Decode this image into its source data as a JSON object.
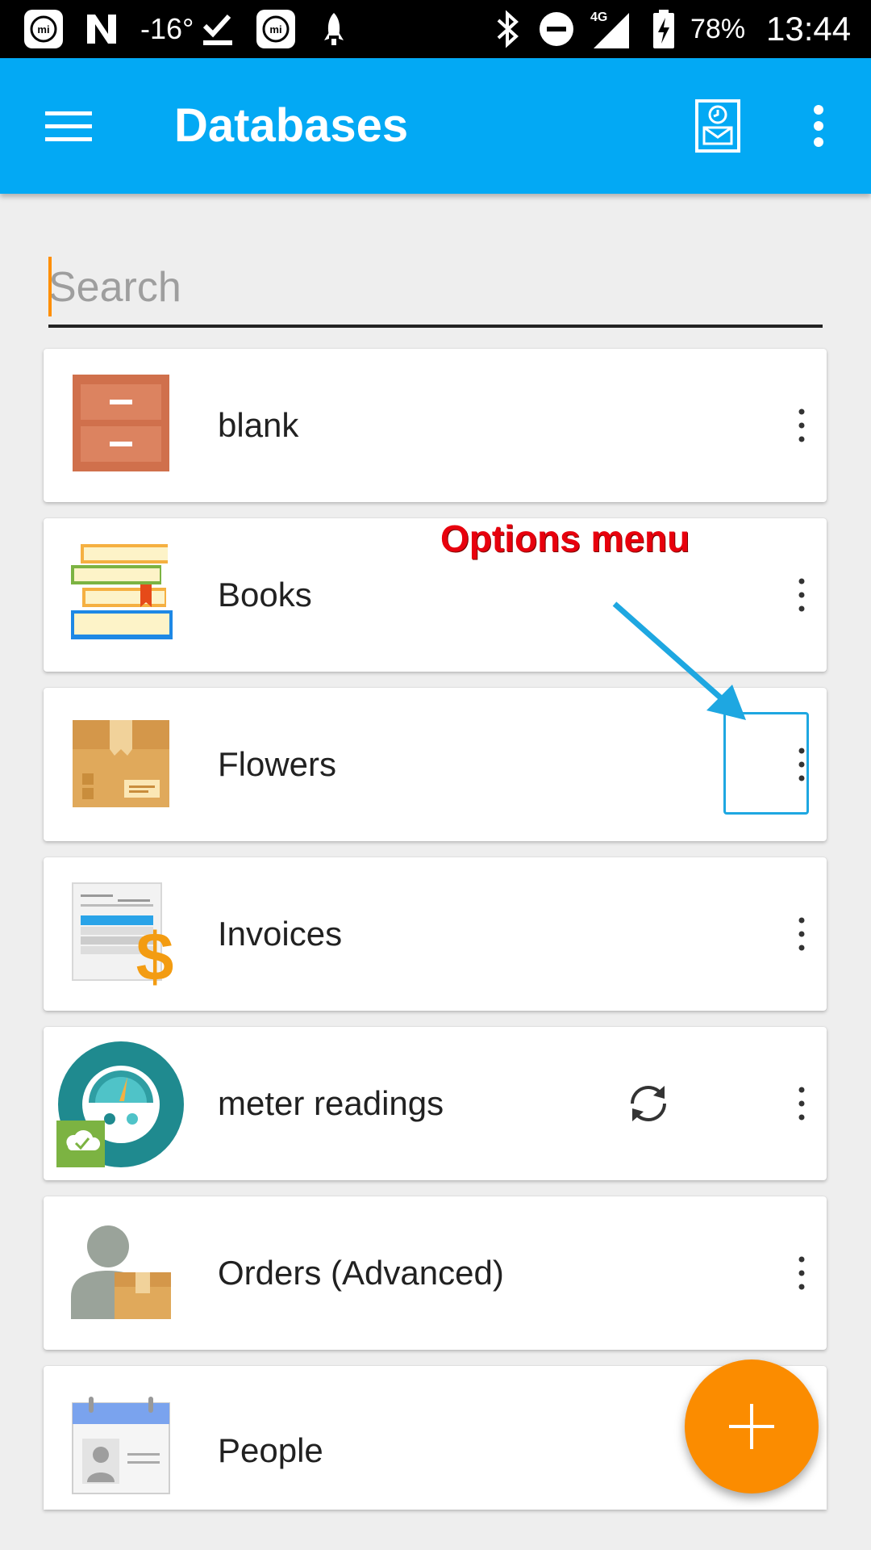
{
  "status_bar": {
    "temperature": "-16°",
    "network": "4G",
    "battery": "78%",
    "time": "13:44"
  },
  "app_bar": {
    "title": "Databases"
  },
  "search": {
    "placeholder": "Search",
    "value": ""
  },
  "databases": [
    {
      "name": "blank",
      "icon": "cabinet-icon"
    },
    {
      "name": "Books",
      "icon": "books-icon"
    },
    {
      "name": "Flowers",
      "icon": "box-icon"
    },
    {
      "name": "Invoices",
      "icon": "invoice-icon"
    },
    {
      "name": "meter readings",
      "icon": "meter-icon",
      "synced": true
    },
    {
      "name": "Orders (Advanced)",
      "icon": "orders-icon"
    },
    {
      "name": "People",
      "icon": "contacts-icon"
    }
  ],
  "annotation": {
    "text": "Options menu",
    "color": "#e8000d"
  },
  "colors": {
    "app_bar": "#03a9f4",
    "fab": "#fb8c00",
    "highlight": "#1ea7e1"
  }
}
